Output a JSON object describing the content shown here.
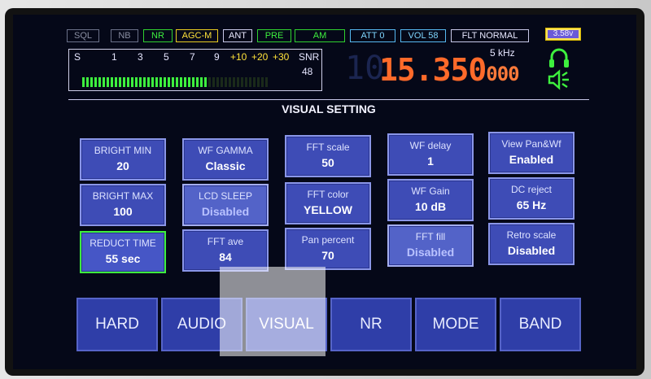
{
  "status": {
    "sql": "SQL",
    "nb": "NB",
    "nr": "NR",
    "agc": "AGC-M",
    "ant": "ANT",
    "pre": "PRE",
    "mode": "AM",
    "att": "ATT 0",
    "vol": "VOL 58",
    "flt": "FLT NORMAL",
    "battery": "3.58v"
  },
  "smeter": {
    "s_label": "S",
    "scale": [
      "1",
      "3",
      "5",
      "7",
      "9"
    ],
    "scale_plus": [
      "+10",
      "+20",
      "+30"
    ],
    "snr_label": "SNR",
    "snr_value": "48",
    "level_fraction": 0.68
  },
  "frequency": {
    "ghost": "10",
    "main": "15.350",
    "fine": "000",
    "step": "5 kHz"
  },
  "icons": {
    "headphone": "headphone-icon",
    "speaker": "speaker-icon"
  },
  "colors": {
    "accent_orange": "#ff6a2a",
    "button_blue": "#3e4cb6",
    "selected_green": "#3ef03e",
    "smeter_green": "#3ef03e"
  },
  "title": "VISUAL SETTING",
  "settings": [
    {
      "label": "BRIGHT MIN",
      "value": "20"
    },
    {
      "label": "WF GAMMA",
      "value": "Classic"
    },
    {
      "label": "FFT scale",
      "value": "50"
    },
    {
      "label": "WF delay",
      "value": "1"
    },
    {
      "label": "View Pan&Wf",
      "value": "Enabled"
    },
    {
      "label": "BRIGHT MAX",
      "value": "100"
    },
    {
      "label": "LCD SLEEP",
      "value": "Disabled"
    },
    {
      "label": "FFT color",
      "value": "YELLOW"
    },
    {
      "label": "WF Gain",
      "value": "10 dB"
    },
    {
      "label": "DC reject",
      "value": "65 Hz"
    },
    {
      "label": "REDUCT TIME",
      "value": "55 sec"
    },
    {
      "label": "FFT ave",
      "value": "84"
    },
    {
      "label": "Pan percent",
      "value": "70"
    },
    {
      "label": "FFT fill",
      "value": "Disabled"
    },
    {
      "label": "Retro scale",
      "value": "Disabled"
    }
  ],
  "tabs": [
    "HARD",
    "AUDIO",
    "VISUAL",
    "NR",
    "MODE",
    "BAND"
  ]
}
